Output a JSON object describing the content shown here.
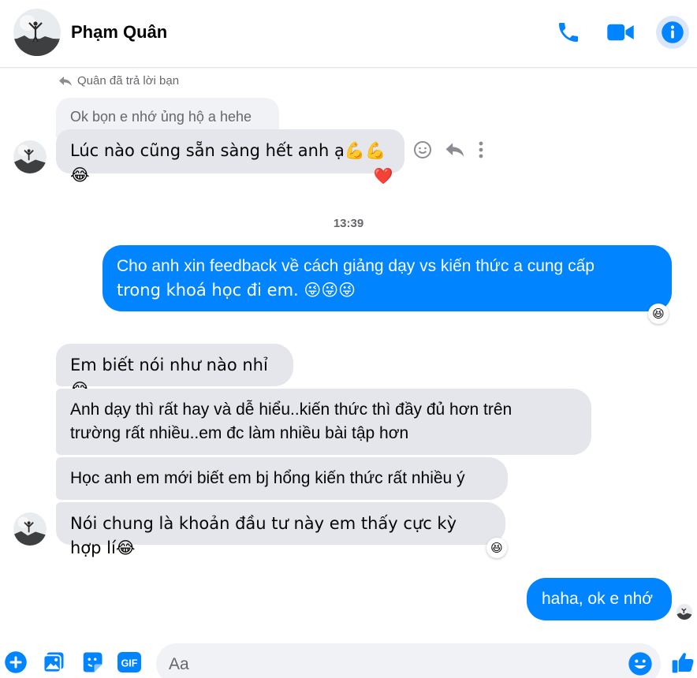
{
  "header": {
    "name": "Phạm Quân",
    "actions": [
      "phone-icon",
      "video-icon",
      "info-icon"
    ],
    "accent": "#0084ff"
  },
  "reply": {
    "note": "Quân đã trả lời bạn",
    "quoted_text": "Ok bọn e nhớ ủng hộ a hehe",
    "message": "Lúc nào cũng sẵn sàng hết anh ạ💪💪😂",
    "reaction": "❤️"
  },
  "timestamp": "13:39",
  "outgoing_1": {
    "line1": "Cho anh xin feedback về cách giảng dạy vs kiến thức a cung cấp",
    "line2": "trong khoá học đi em. 😜😜😜",
    "reaction": "😆"
  },
  "incoming": [
    {
      "text": "Em biết nói như nào nhỉ😂"
    },
    {
      "line1": "Anh dạy thì rất hay và dễ hiểu..kiến thức thì đầy đủ hơn trên",
      "line2": "trường rất nhiều..em đc làm nhiều bài tập hơn"
    },
    {
      "text": "Học anh em mới biết em bj hổng kiến thức rất nhiều ý"
    },
    {
      "text": "Nói chung là khoản đầu tư này em thấy cực kỳ hợp lí😂",
      "reaction": "😆"
    }
  ],
  "outgoing_2": {
    "text": "haha, ok e nhớ"
  },
  "composer": {
    "placeholder": "Aa",
    "icons": [
      "plus-icon",
      "image-icon",
      "sticker-icon",
      "gif-icon",
      "emoji-icon",
      "like-icon"
    ],
    "gif_label": "GIF"
  },
  "colors": {
    "bubble_in": "#e4e6eb",
    "bubble_out": "#0084ff",
    "muted": "#65676b"
  }
}
